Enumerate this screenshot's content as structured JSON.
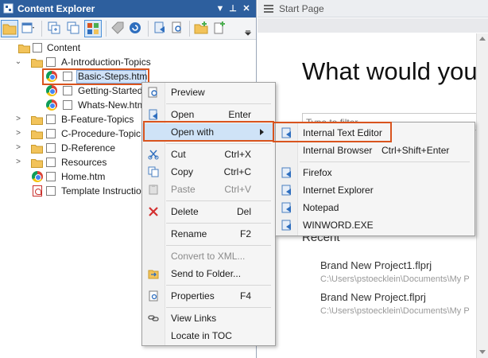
{
  "left_panel": {
    "title": "Content Explorer",
    "title_buttons": [
      "▼",
      "⊥",
      "✕"
    ],
    "toolbar_icons": [
      "folder-icon",
      "layout-icon",
      "new-window-icon",
      "copy-window-icon",
      "grid-icon",
      "tag-icon",
      "refresh-icon",
      "move-icon",
      "search-doc-icon",
      "new-folder-icon",
      "add-file-icon",
      "overflow-icon"
    ],
    "tree": [
      {
        "label": "Content",
        "type": "folder",
        "depth": 0,
        "expander": ""
      },
      {
        "label": "A-Introduction-Topics",
        "type": "folder",
        "depth": 1,
        "expander": "⌄"
      },
      {
        "label": "Basic-Steps.htm",
        "type": "chrome",
        "depth": 2,
        "expander": ""
      },
      {
        "label": "Getting-Started",
        "type": "chrome",
        "depth": 2,
        "expander": ""
      },
      {
        "label": "Whats-New.htm",
        "type": "chrome",
        "depth": 2,
        "expander": ""
      },
      {
        "label": "B-Feature-Topics",
        "type": "folder",
        "depth": 1,
        "expander": ">"
      },
      {
        "label": "C-Procedure-Topic",
        "type": "folder",
        "depth": 1,
        "expander": ">"
      },
      {
        "label": "D-Reference",
        "type": "folder",
        "depth": 1,
        "expander": ">"
      },
      {
        "label": "Resources",
        "type": "folder",
        "depth": 1,
        "expander": ">"
      },
      {
        "label": "Home.htm",
        "type": "chrome",
        "depth": 1,
        "expander": ""
      },
      {
        "label": "Template Instructio",
        "type": "pdf",
        "depth": 1,
        "expander": ""
      }
    ]
  },
  "right_panel": {
    "tab_title": "Start Page",
    "headline": "What would you li",
    "filter_placeholder": "Type to filter",
    "recent_heading": "Recent",
    "recent_items": [
      {
        "title": "Brand New Project1.flprj",
        "path": "C:\\Users\\pstoecklein\\Documents\\My P"
      },
      {
        "title": "Brand New Project.flprj",
        "path": "C:\\Users\\pstoecklein\\Documents\\My P"
      }
    ]
  },
  "context_menu": {
    "items": [
      {
        "label": "Preview",
        "shortcut": "",
        "icon": "preview-icon",
        "disabled": false
      },
      {
        "label": "Open",
        "shortcut": "Enter",
        "icon": "open-icon",
        "disabled": false
      },
      {
        "label": "Open with",
        "shortcut": "",
        "icon": "",
        "disabled": false,
        "submenu": true
      },
      {
        "label": "Cut",
        "shortcut": "Ctrl+X",
        "icon": "cut-icon",
        "disabled": false
      },
      {
        "label": "Copy",
        "shortcut": "Ctrl+C",
        "icon": "copy-icon",
        "disabled": false
      },
      {
        "label": "Paste",
        "shortcut": "Ctrl+V",
        "icon": "paste-icon",
        "disabled": true
      },
      {
        "label": "Delete",
        "shortcut": "Del",
        "icon": "delete-icon",
        "disabled": false
      },
      {
        "label": "Rename",
        "shortcut": "F2",
        "icon": "",
        "disabled": false
      },
      {
        "label": "Convert to XML...",
        "shortcut": "",
        "icon": "",
        "disabled": true
      },
      {
        "label": "Send to Folder...",
        "shortcut": "",
        "icon": "send-folder-icon",
        "disabled": false
      },
      {
        "label": "Properties",
        "shortcut": "F4",
        "icon": "properties-icon",
        "disabled": false
      },
      {
        "label": "View Links",
        "shortcut": "",
        "icon": "links-icon",
        "disabled": false
      },
      {
        "label": "Locate in TOC",
        "shortcut": "",
        "icon": "",
        "disabled": false
      }
    ]
  },
  "open_with_submenu": {
    "items": [
      {
        "label": "Internal Text Editor",
        "shortcut": ""
      },
      {
        "label": "Internal Browser",
        "shortcut": "Ctrl+Shift+Enter"
      },
      {
        "label": "Firefox",
        "shortcut": ""
      },
      {
        "label": "Internet Explorer",
        "shortcut": ""
      },
      {
        "label": "Notepad",
        "shortcut": ""
      },
      {
        "label": "WINWORD.EXE",
        "shortcut": ""
      }
    ]
  },
  "colors": {
    "title_bar": "#2d5f9e",
    "highlight_outline": "#d9541e",
    "selection": "#cfe3f7"
  }
}
